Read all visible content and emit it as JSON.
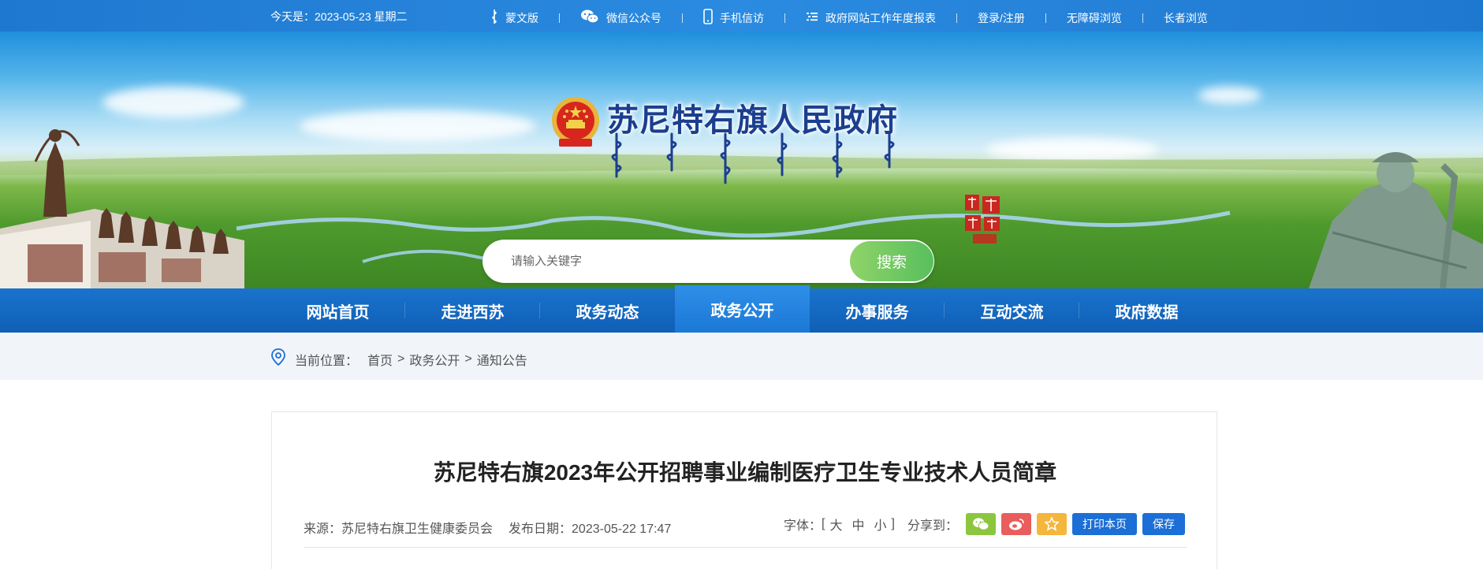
{
  "topbar": {
    "date_text": "今天是：2023-05-23 星期二",
    "links": [
      {
        "label": "蒙文版",
        "icon": "mongolian-script-icon"
      },
      {
        "label": "微信公众号",
        "icon": "wechat-icon"
      },
      {
        "label": "手机信访",
        "icon": "mobile-phone-icon"
      },
      {
        "label": "政府网站工作年度报表",
        "icon": "report-list-icon"
      },
      {
        "label": "登录/注册",
        "icon": ""
      },
      {
        "label": "无障碍浏览",
        "icon": ""
      },
      {
        "label": "长者浏览",
        "icon": ""
      }
    ]
  },
  "header": {
    "site_title": "苏尼特右旗人民政府",
    "emblem_icon": "national-emblem-icon",
    "seal_icon": "calligraphy-seal-icon"
  },
  "search": {
    "placeholder": "请输入关键字",
    "button_label": "搜索"
  },
  "nav": {
    "items": [
      {
        "label": "网站首页",
        "active": false
      },
      {
        "label": "走进西苏",
        "active": false
      },
      {
        "label": "政务动态",
        "active": false
      },
      {
        "label": "政务公开",
        "active": true
      },
      {
        "label": "办事服务",
        "active": false
      },
      {
        "label": "互动交流",
        "active": false
      },
      {
        "label": "政府数据",
        "active": false
      }
    ]
  },
  "breadcrumb": {
    "prefix": "当前位置：",
    "items": [
      "首页",
      "政务公开",
      "通知公告"
    ],
    "separator": ">"
  },
  "article": {
    "title": "苏尼特右旗2023年公开招聘事业编制医疗卫生专业技术人员简章",
    "source": "来源：苏尼特右旗卫生健康委员会",
    "publish_date": "发布日期：2023-05-22 17:47",
    "font_label": "字体：",
    "font_open": "[",
    "font_sizes": [
      "大",
      "中",
      "小"
    ],
    "font_close": "]",
    "share_label": "分享到：",
    "print_label": "打印本页",
    "save_label": "保存"
  },
  "colors": {
    "topbar": "#1f78cf",
    "nav": "#0f5fb6",
    "nav_active": "#2f8fe8",
    "search_button": "#58bf5c",
    "title_text": "#1b3f8f",
    "action_button": "#1c6fd6"
  }
}
